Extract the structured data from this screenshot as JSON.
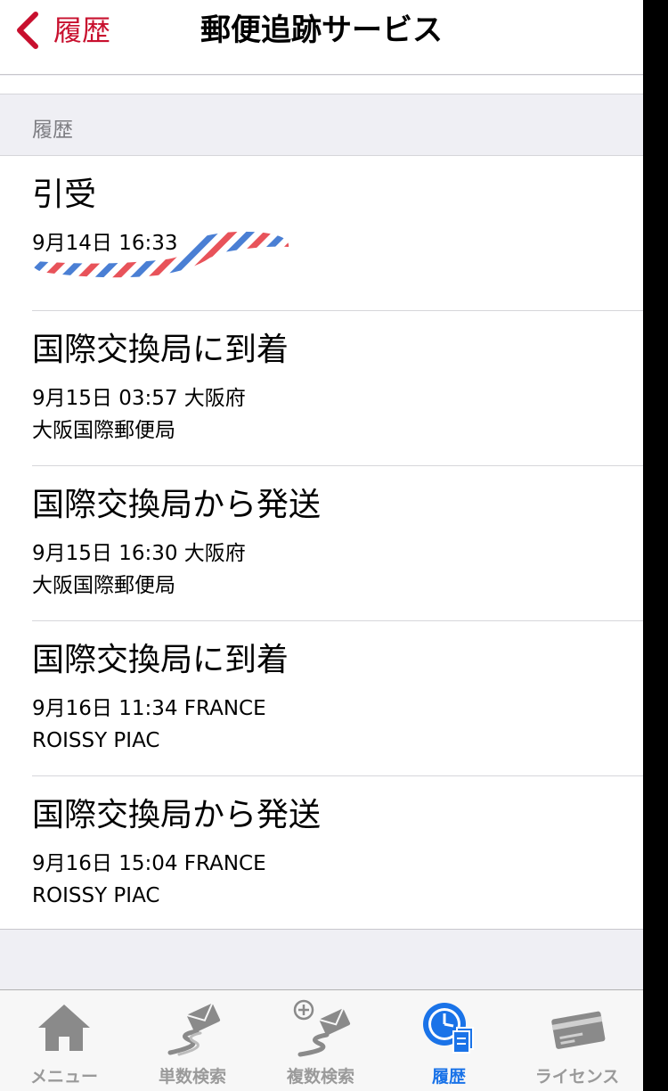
{
  "nav": {
    "back_label": "履歴",
    "title": "郵便追跡サービス"
  },
  "section": {
    "header": "履歴"
  },
  "history": [
    {
      "status": "引受",
      "detail": "9月14日 16:33",
      "office": ""
    },
    {
      "status": "国際交換局に到着",
      "detail": "9月15日 03:57 大阪府",
      "office": "大阪国際郵便局"
    },
    {
      "status": "国際交換局から発送",
      "detail": "9月15日 16:30 大阪府",
      "office": "大阪国際郵便局"
    },
    {
      "status": "国際交換局に到着",
      "detail": "9月16日 11:34 FRANCE",
      "office": "ROISSY PIAC"
    },
    {
      "status": "国際交換局から発送",
      "detail": "9月16日 15:04 FRANCE",
      "office": "ROISSY PIAC"
    }
  ],
  "tabs": [
    {
      "label": "メニュー",
      "icon": "home-icon",
      "active": false
    },
    {
      "label": "単数検索",
      "icon": "single-search-icon",
      "active": false
    },
    {
      "label": "複数検索",
      "icon": "multi-search-icon",
      "active": false
    },
    {
      "label": "履歴",
      "icon": "history-icon",
      "active": true
    },
    {
      "label": "ライセンス",
      "icon": "license-icon",
      "active": false
    }
  ],
  "colors": {
    "accent": "#c8102e",
    "tab_active": "#1a73e8",
    "tab_inactive": "#9a9a9a",
    "stripe_red": "#e8535a",
    "stripe_blue": "#4a7fd4"
  }
}
